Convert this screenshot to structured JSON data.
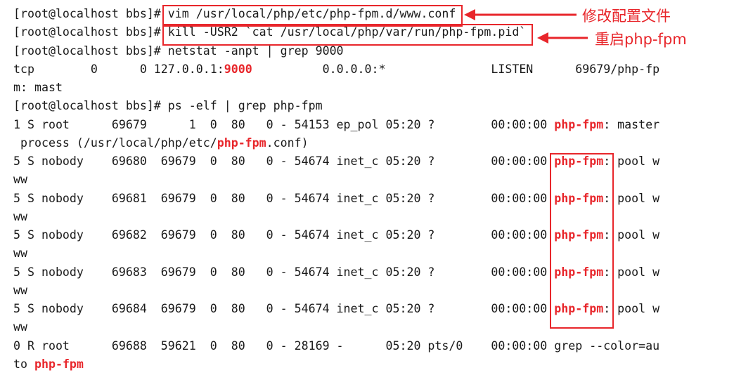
{
  "terminal": {
    "lines": [
      [
        {
          "t": "[root@localhost bbs]# "
        },
        {
          "t": "vim /usr/local/php/etc/php-fpm.d/www.conf"
        }
      ],
      [
        {
          "t": "[root@localhost bbs]# "
        },
        {
          "t": "kill -USR2 `cat /usr/local/php/var/run/php-fpm.pid`"
        }
      ],
      [
        {
          "t": "[root@localhost bbs]# netstat -anpt | grep 9000"
        }
      ],
      [
        {
          "t": "tcp        0      0 127.0.0.1:"
        },
        {
          "t": "9000",
          "hl": true
        },
        {
          "t": "          0.0.0.0:*               LISTEN      69679/php-fp"
        }
      ],
      [
        {
          "t": "m: mast"
        }
      ],
      [
        {
          "t": "[root@localhost bbs]# ps -elf | grep php-fpm"
        }
      ],
      [
        {
          "t": "1 S root      69679      1  0  80   0 - 54153 ep_pol 05:20 ?        00:00:00 "
        },
        {
          "t": "php-fpm",
          "hl": true
        },
        {
          "t": ": master"
        }
      ],
      [
        {
          "t": " process (/usr/local/php/etc/"
        },
        {
          "t": "php-fpm",
          "hl": true
        },
        {
          "t": ".conf)"
        }
      ],
      [
        {
          "t": "5 S nobody    69680  69679  0  80   0 - 54674 inet_c 05:20 ?        00:00:00 "
        },
        {
          "t": "php-fpm",
          "hl": true
        },
        {
          "t": ": pool w"
        }
      ],
      [
        {
          "t": "ww"
        }
      ],
      [
        {
          "t": "5 S nobody    69681  69679  0  80   0 - 54674 inet_c 05:20 ?        00:00:00 "
        },
        {
          "t": "php-fpm",
          "hl": true
        },
        {
          "t": ": pool w"
        }
      ],
      [
        {
          "t": "ww"
        }
      ],
      [
        {
          "t": "5 S nobody    69682  69679  0  80   0 - 54674 inet_c 05:20 ?        00:00:00 "
        },
        {
          "t": "php-fpm",
          "hl": true
        },
        {
          "t": ": pool w"
        }
      ],
      [
        {
          "t": "ww"
        }
      ],
      [
        {
          "t": "5 S nobody    69683  69679  0  80   0 - 54674 inet_c 05:20 ?        00:00:00 "
        },
        {
          "t": "php-fpm",
          "hl": true
        },
        {
          "t": ": pool w"
        }
      ],
      [
        {
          "t": "ww"
        }
      ],
      [
        {
          "t": "5 S nobody    69684  69679  0  80   0 - 54674 inet_c 05:20 ?        00:00:00 "
        },
        {
          "t": "php-fpm",
          "hl": true
        },
        {
          "t": ": pool w"
        }
      ],
      [
        {
          "t": "ww"
        }
      ],
      [
        {
          "t": "0 R root      69688  59621  0  80   0 - 28169 -      05:20 pts/0    00:00:00 grep --color=au"
        }
      ],
      [
        {
          "t": "to "
        },
        {
          "t": "php-fpm",
          "hl": true
        }
      ]
    ]
  },
  "annotations": {
    "edit_config": "修改配置文件",
    "restart_fpm": "重启php-fpm"
  },
  "colors": {
    "highlight": "#e8262b",
    "text": "#1a1a1a",
    "background": "#ffffff"
  }
}
